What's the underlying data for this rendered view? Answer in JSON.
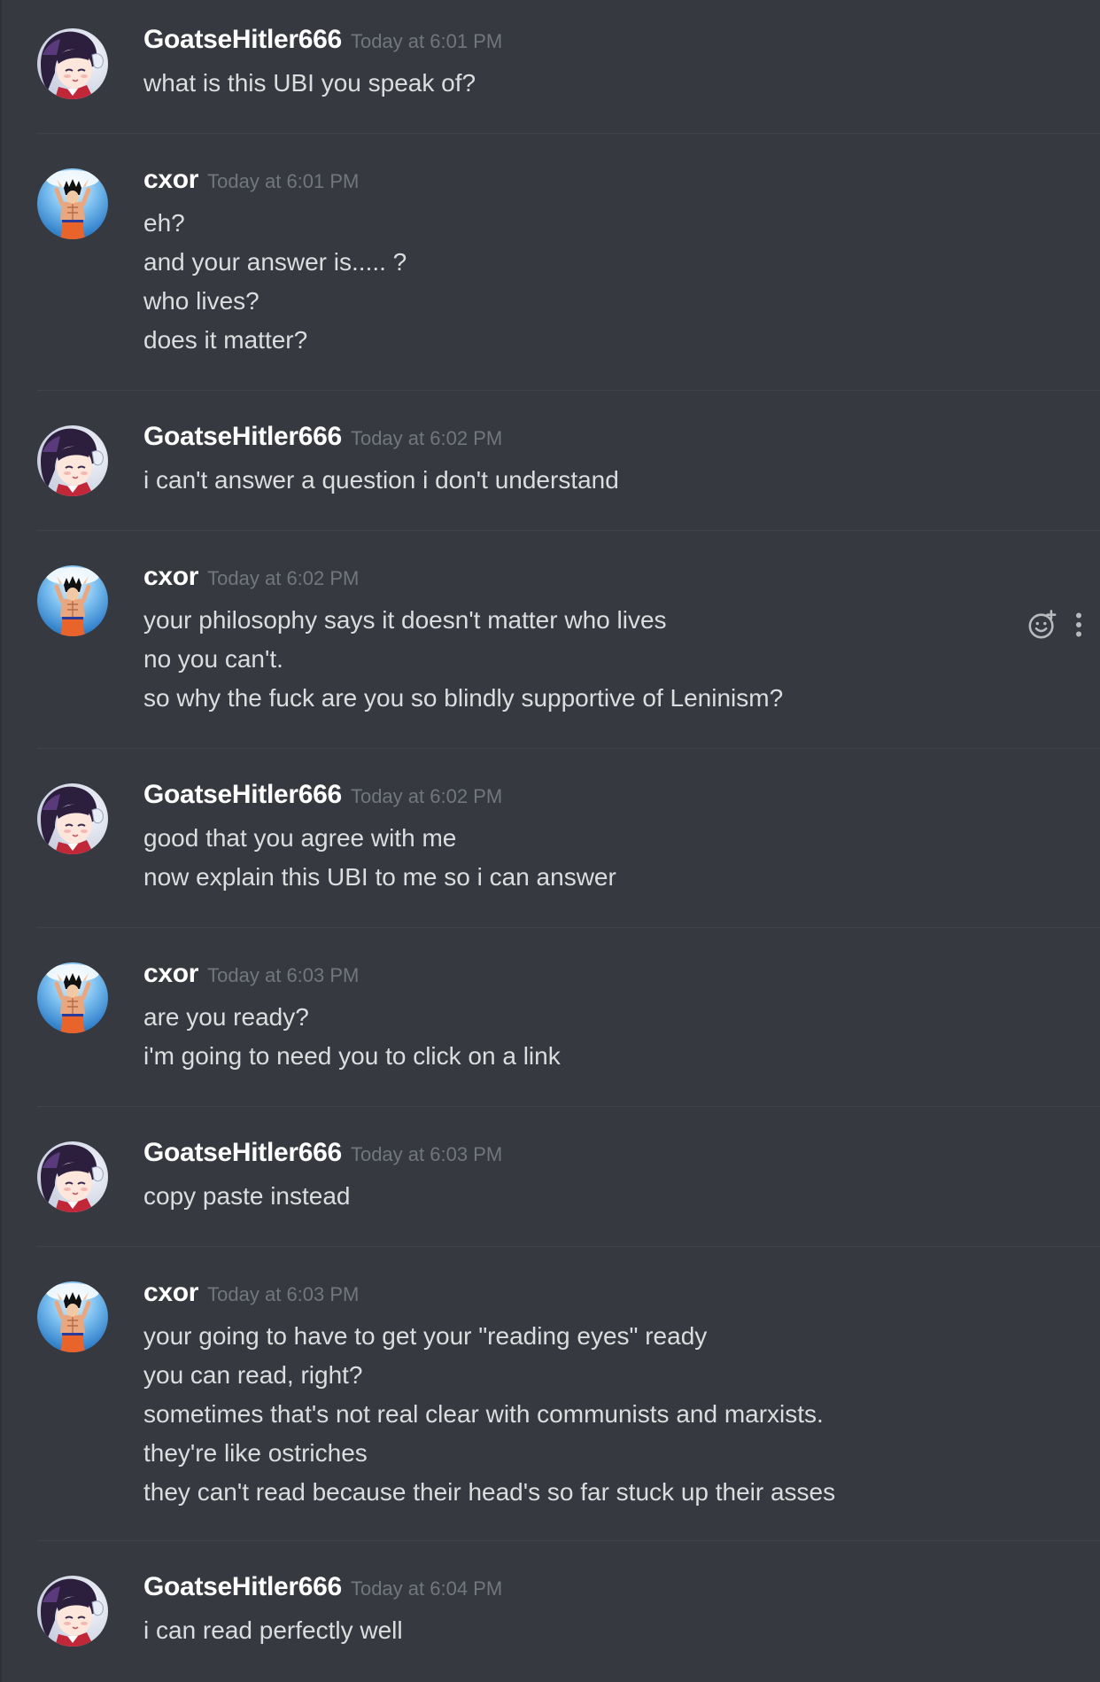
{
  "colors": {
    "background": "#36393f",
    "username": "#ffffff",
    "timestamp": "#72767d",
    "message_text": "#dcddde",
    "divider": "#40434a",
    "icon": "#b9bbbe"
  },
  "messages": [
    {
      "author": "GoatseHitler666",
      "timestamp": "Today at 6:01 PM",
      "avatar_icon": "anime-girl-avatar",
      "lines": [
        "what is this UBI you speak of?"
      ]
    },
    {
      "author": "cxor",
      "timestamp": "Today at 6:01 PM",
      "avatar_icon": "goku-avatar",
      "lines": [
        "eh?",
        "and your answer is..... ?",
        "who lives?",
        "does it matter?"
      ]
    },
    {
      "author": "GoatseHitler666",
      "timestamp": "Today at 6:02 PM",
      "avatar_icon": "anime-girl-avatar",
      "lines": [
        "i can't answer a question i don't understand"
      ]
    },
    {
      "author": "cxor",
      "timestamp": "Today at 6:02 PM",
      "avatar_icon": "goku-avatar",
      "lines": [
        "your philosophy says it doesn't matter who lives",
        "no you can't.",
        "so why the fuck are you so blindly supportive of Leninism?"
      ]
    },
    {
      "author": "GoatseHitler666",
      "timestamp": "Today at 6:02 PM",
      "avatar_icon": "anime-girl-avatar",
      "lines": [
        "good that you agree with me",
        "now explain this UBI to me so i can answer"
      ]
    },
    {
      "author": "cxor",
      "timestamp": "Today at 6:03 PM",
      "avatar_icon": "goku-avatar",
      "lines": [
        "are you ready?",
        "i'm going to need you to click on a link"
      ]
    },
    {
      "author": "GoatseHitler666",
      "timestamp": "Today at 6:03 PM",
      "avatar_icon": "anime-girl-avatar",
      "lines": [
        "copy paste instead"
      ]
    },
    {
      "author": "cxor",
      "timestamp": "Today at 6:03 PM",
      "avatar_icon": "goku-avatar",
      "lines": [
        "your going to have to get your \"reading eyes\" ready",
        "you can read, right?",
        "sometimes that's not real clear with communists and marxists.",
        "they're like ostriches",
        "they can't read because their head's so far stuck up their asses"
      ]
    },
    {
      "author": "GoatseHitler666",
      "timestamp": "Today at 6:04 PM",
      "avatar_icon": "anime-girl-avatar",
      "lines": [
        "i can read perfectly well"
      ]
    }
  ],
  "hover_actions": {
    "message_index": 3,
    "icons": [
      "add-reaction-icon",
      "more-options-icon"
    ]
  }
}
